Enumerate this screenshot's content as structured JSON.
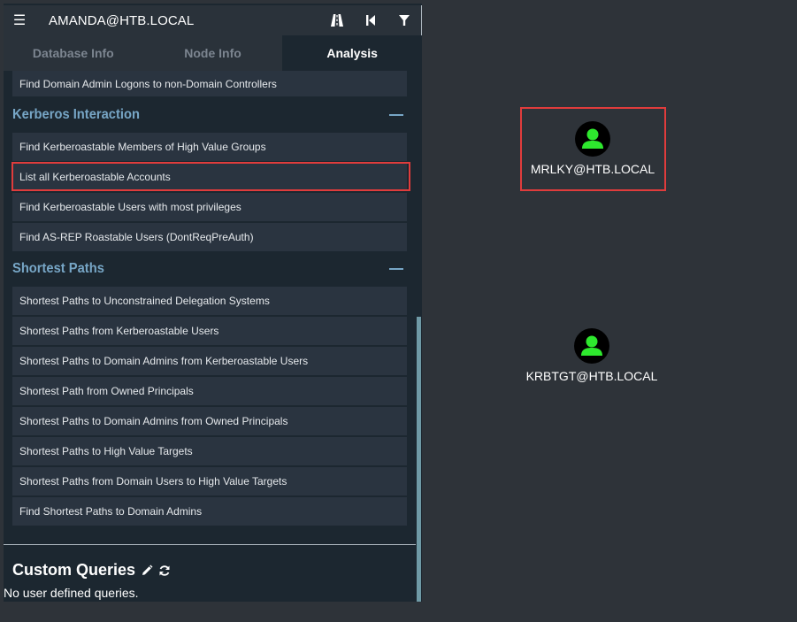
{
  "search": {
    "value": "AMANDA@HTB.LOCAL"
  },
  "tabs": [
    {
      "label": "Database Info"
    },
    {
      "label": "Node Info"
    },
    {
      "label": "Analysis"
    }
  ],
  "queries": {
    "top_item": "Find Domain Admin Logons to non-Domain Controllers",
    "kerberos": {
      "title": "Kerberos Interaction",
      "items": [
        "Find Kerberoastable Members of High Value Groups",
        "List all Kerberoastable Accounts",
        "Find Kerberoastable Users with most privileges",
        "Find AS-REP Roastable Users (DontReqPreAuth)"
      ]
    },
    "shortest": {
      "title": "Shortest Paths",
      "items": [
        "Shortest Paths to Unconstrained Delegation Systems",
        "Shortest Paths from Kerberoastable Users",
        "Shortest Paths to Domain Admins from Kerberoastable Users",
        "Shortest Path from Owned Principals",
        "Shortest Paths to Domain Admins from Owned Principals",
        "Shortest Paths to High Value Targets",
        "Shortest Paths from Domain Users to High Value Targets",
        "Find Shortest Paths to Domain Admins"
      ]
    }
  },
  "custom": {
    "title": "Custom Queries",
    "empty_text": "No user defined queries."
  },
  "graph": {
    "nodes": [
      {
        "label": "MRLKY@HTB.LOCAL"
      },
      {
        "label": "KRBTGT@HTB.LOCAL"
      }
    ]
  },
  "colors": {
    "node_icon": "#2ee82e",
    "section_title": "#77a6c6",
    "highlight": "#e03c3c",
    "background": "#2e3339"
  }
}
